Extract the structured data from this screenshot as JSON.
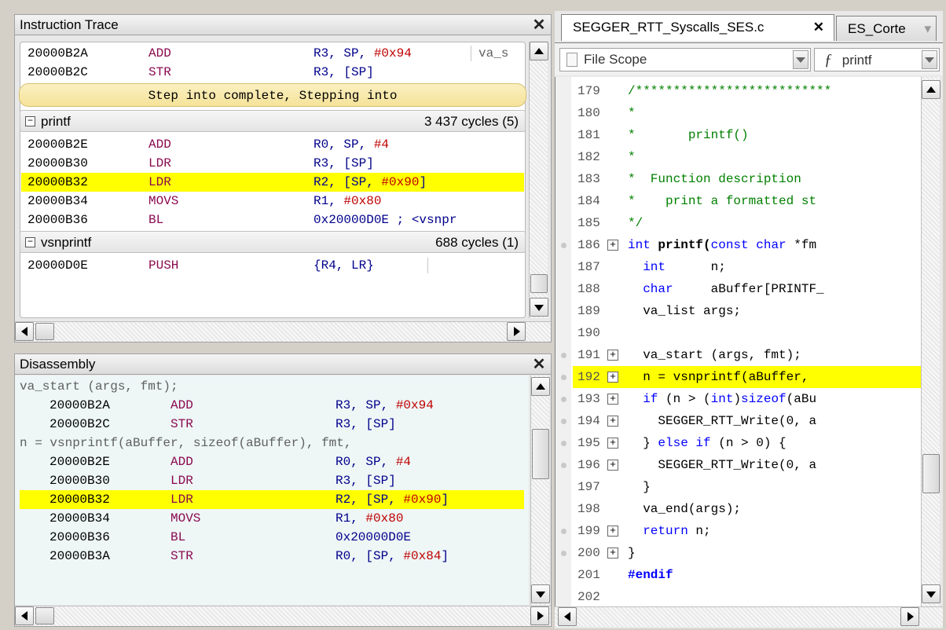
{
  "colors": {
    "highlight": "#ffff00",
    "mnemonic": "#8b0a50",
    "register": "#00008b",
    "number": "#c00000",
    "keyword": "#0000ff",
    "comment": "#008000"
  },
  "trace": {
    "title": "Instruction Trace",
    "close": "✕",
    "pre_rows": [
      {
        "addr": "20000B2A",
        "mn": "ADD",
        "op_reg": "R3, SP, ",
        "op_num": "#0x94",
        "cmt": "va_s"
      },
      {
        "addr": "20000B2C",
        "mn": "STR",
        "op_reg": "R3, [SP]",
        "op_num": "",
        "cmt": ""
      }
    ],
    "banner": "Step into complete, Stepping into",
    "group1": {
      "name": "printf",
      "cycles": "3 437 cycles (5)"
    },
    "group1_rows": [
      {
        "addr": "20000B2E",
        "mn": "ADD",
        "op_reg": "R0, SP, ",
        "op_num": "#4",
        "op_tail": ""
      },
      {
        "addr": "20000B30",
        "mn": "LDR",
        "op_reg": "R3, [SP]",
        "op_num": "",
        "op_tail": ""
      },
      {
        "addr": "20000B32",
        "mn": "LDR",
        "op_reg": "R2, [SP, ",
        "op_num": "#0x90",
        "op_tail": "]"
      },
      {
        "addr": "20000B34",
        "mn": "MOVS",
        "op_reg": "R1, ",
        "op_num": "#0x80",
        "op_tail": ""
      },
      {
        "addr": "20000B36",
        "mn": "BL",
        "op_reg": "0x20000D0E ; <vsnpr",
        "op_num": "",
        "op_tail": ""
      }
    ],
    "group2": {
      "name": "vsnprintf",
      "cycles": "688 cycles (1)"
    },
    "group2_rows": [
      {
        "addr": "20000D0E",
        "mn": "PUSH",
        "op_reg": "{R4, LR}",
        "op_num": "",
        "op_tail": ""
      }
    ]
  },
  "disasm": {
    "title": "Disassembly",
    "close": "✕",
    "source1": "va_start (args, fmt);",
    "rows1": [
      {
        "addr": "20000B2A",
        "mn": "ADD",
        "op_reg": "R3, SP, ",
        "op_num": "#0x94",
        "op_tail": ""
      },
      {
        "addr": "20000B2C",
        "mn": "STR",
        "op_reg": "R3, [SP]",
        "op_num": "",
        "op_tail": ""
      }
    ],
    "source2": "n = vsnprintf(aBuffer, sizeof(aBuffer), fmt,",
    "rows2": [
      {
        "addr": "20000B2E",
        "mn": "ADD",
        "op_reg": "R0, SP, ",
        "op_num": "#4",
        "op_tail": ""
      },
      {
        "addr": "20000B30",
        "mn": "LDR",
        "op_reg": "R3, [SP]",
        "op_num": "",
        "op_tail": ""
      },
      {
        "addr": "20000B32",
        "mn": "LDR",
        "op_reg": "R2, [SP, ",
        "op_num": "#0x90",
        "op_tail": "]"
      },
      {
        "addr": "20000B34",
        "mn": "MOVS",
        "op_reg": "R1, ",
        "op_num": "#0x80",
        "op_tail": ""
      },
      {
        "addr": "20000B36",
        "mn": "BL",
        "op_reg": "0x20000D0E",
        "op_num": "",
        "op_tail": ""
      },
      {
        "addr": "20000B3A",
        "mn": "STR",
        "op_reg": "R0, [SP, ",
        "op_num": "#0x84",
        "op_tail": "]"
      }
    ]
  },
  "editor": {
    "tab_active": "SEGGER_RTT_Syscalls_SES.c",
    "tab_close": "✕",
    "tab_inactive": "ES_Corte",
    "scope_combo": "File Scope",
    "func_combo_icon": "ƒ",
    "func_combo": "printf",
    "lines": [
      {
        "n": "179",
        "dot": false,
        "plus": false,
        "parts": [
          [
            "s",
            "/**************************"
          ]
        ]
      },
      {
        "n": "180",
        "dot": false,
        "plus": false,
        "parts": [
          [
            "s",
            "*"
          ]
        ]
      },
      {
        "n": "181",
        "dot": false,
        "plus": false,
        "parts": [
          [
            "s",
            "*       printf()"
          ]
        ]
      },
      {
        "n": "182",
        "dot": false,
        "plus": false,
        "parts": [
          [
            "s",
            "*"
          ]
        ]
      },
      {
        "n": "183",
        "dot": false,
        "plus": false,
        "parts": [
          [
            "s",
            "*  Function description"
          ]
        ]
      },
      {
        "n": "184",
        "dot": false,
        "plus": false,
        "parts": [
          [
            "s",
            "*    print a formatted st"
          ]
        ]
      },
      {
        "n": "185",
        "dot": false,
        "plus": false,
        "parts": [
          [
            "s",
            "*/"
          ]
        ]
      },
      {
        "n": "186",
        "dot": true,
        "plus": true,
        "parts": [
          [
            "k",
            "int "
          ],
          [
            "b",
            "printf("
          ],
          [
            "k",
            "const char "
          ],
          [
            "",
            "*fm"
          ]
        ]
      },
      {
        "n": "187",
        "dot": false,
        "plus": false,
        "parts": [
          [
            "",
            "  "
          ],
          [
            "k",
            "int"
          ],
          [
            "",
            "      n;"
          ]
        ]
      },
      {
        "n": "188",
        "dot": false,
        "plus": false,
        "parts": [
          [
            "",
            "  "
          ],
          [
            "k",
            "char"
          ],
          [
            "",
            "     aBuffer[PRINTF_"
          ]
        ]
      },
      {
        "n": "189",
        "dot": false,
        "plus": false,
        "parts": [
          [
            "",
            "  va_list args;"
          ]
        ]
      },
      {
        "n": "190",
        "dot": false,
        "plus": false,
        "parts": [
          [
            "",
            ""
          ]
        ]
      },
      {
        "n": "191",
        "dot": true,
        "plus": true,
        "parts": [
          [
            "",
            "  va_start (args, fmt);"
          ]
        ]
      },
      {
        "n": "192",
        "dot": true,
        "plus": true,
        "hl": true,
        "parts": [
          [
            "",
            "  n = vsnprintf(aBuffer,"
          ]
        ]
      },
      {
        "n": "193",
        "dot": true,
        "plus": true,
        "parts": [
          [
            "",
            "  "
          ],
          [
            "k",
            "if"
          ],
          [
            "",
            " (n > ("
          ],
          [
            "k",
            "int"
          ],
          [
            "",
            ")"
          ],
          [
            "k",
            "sizeof"
          ],
          [
            "",
            "(aBu"
          ]
        ]
      },
      {
        "n": "194",
        "dot": true,
        "plus": true,
        "parts": [
          [
            "",
            "    SEGGER_RTT_Write(0, a"
          ]
        ]
      },
      {
        "n": "195",
        "dot": true,
        "plus": true,
        "parts": [
          [
            "",
            "  } "
          ],
          [
            "k",
            "else if"
          ],
          [
            "",
            " (n > 0) {"
          ]
        ]
      },
      {
        "n": "196",
        "dot": true,
        "plus": true,
        "parts": [
          [
            "",
            "    SEGGER_RTT_Write(0, a"
          ]
        ]
      },
      {
        "n": "197",
        "dot": false,
        "plus": false,
        "parts": [
          [
            "",
            "  }"
          ]
        ]
      },
      {
        "n": "198",
        "dot": false,
        "plus": false,
        "parts": [
          [
            "",
            "  va_end(args);"
          ]
        ]
      },
      {
        "n": "199",
        "dot": true,
        "plus": true,
        "parts": [
          [
            "",
            "  "
          ],
          [
            "k",
            "return"
          ],
          [
            "",
            " n;"
          ]
        ]
      },
      {
        "n": "200",
        "dot": true,
        "plus": true,
        "parts": [
          [
            "",
            "}"
          ]
        ]
      },
      {
        "n": "201",
        "dot": false,
        "plus": false,
        "parts": [
          [
            "pp",
            "#endif"
          ]
        ]
      },
      {
        "n": "202",
        "dot": false,
        "plus": false,
        "parts": [
          [
            "",
            ""
          ]
        ]
      }
    ]
  }
}
